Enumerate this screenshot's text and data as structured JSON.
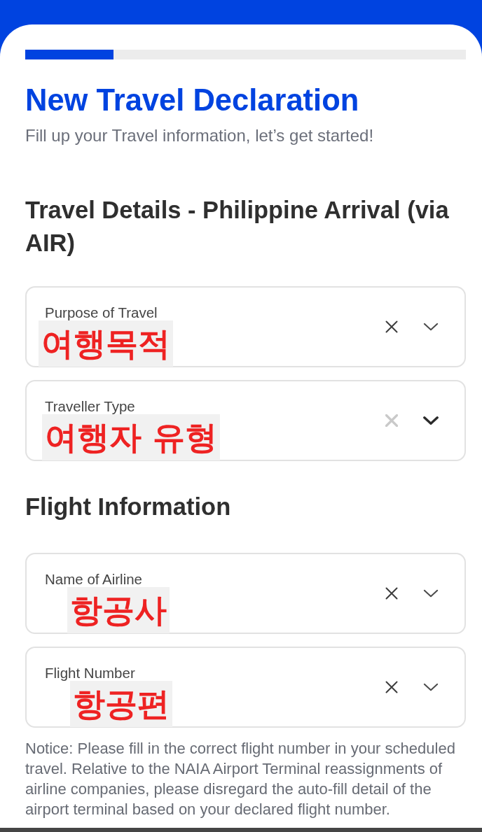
{
  "header": {
    "progress": {
      "level": 0.2
    },
    "title": "New Travel Declaration",
    "subtitle": "Fill up your Travel information, let’s get started!"
  },
  "sections": [
    {
      "heading": "Travel Details - Philippine Arrival (via AIR)",
      "fields": [
        {
          "label": "Purpose of Travel",
          "annotation": "여행목적",
          "clear_enabled": true,
          "chevron_emphasized": false
        },
        {
          "label": "Traveller Type",
          "annotation": "여행자 유형",
          "clear_enabled": false,
          "chevron_emphasized": true
        }
      ]
    },
    {
      "heading": "Flight Information",
      "fields": [
        {
          "label": "Name of Airline",
          "annotation": "항공사",
          "clear_enabled": true,
          "chevron_emphasized": false
        },
        {
          "label": "Flight Number",
          "annotation": "항공편",
          "clear_enabled": true,
          "chevron_emphasized": false
        }
      ],
      "notice": "Notice: Please fill in the correct flight number in your scheduled travel. Relative to the NAIA Airport Terminal reassignments of airline companies, please disregard the auto-fill detail of the airport terminal based on your declared flight number."
    }
  ]
}
